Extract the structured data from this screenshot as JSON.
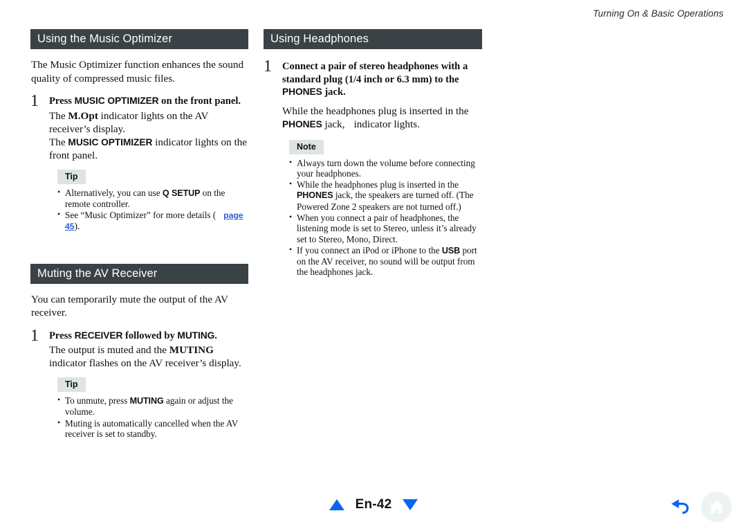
{
  "header": {
    "running_title": "Turning On & Basic Operations"
  },
  "left_column": {
    "sections": [
      {
        "heading": "Using the Music Optimizer",
        "intro": "The Music Optimizer function enhances the sound quality of compressed music files.",
        "step_number": "1",
        "step_title_pre": "Press ",
        "step_title_key": "MUSIC OPTIMIZER",
        "step_title_post": " on the front panel.",
        "body_1_a": "The ",
        "body_1_key": "M.Opt",
        "body_1_b": " indicator lights on the AV receiver’s display.",
        "body_2_a": "The ",
        "body_2_key": "MUSIC OPTIMIZER",
        "body_2_b": " indicator lights on the front panel.",
        "callout_label": "Tip",
        "bullets": [
          {
            "pre": "Alternatively, you can use ",
            "key": "Q SETUP",
            "post": " on the remote controller."
          },
          {
            "pre": "See “Music Optimizer” for more details (",
            "link": "page 45",
            "post": ")."
          }
        ]
      },
      {
        "heading": "Muting the AV Receiver",
        "intro": "You can temporarily mute the output of the AV receiver.",
        "step_number": "1",
        "step_title_pre": "Press ",
        "step_title_key": "RECEIVER",
        "step_title_mid": " followed by ",
        "step_title_key2": "MUTING",
        "step_title_post": ".",
        "body_1_a": "The output is muted and the ",
        "body_1_key": "MUTING",
        "body_1_b": " indicator flashes on the AV receiver’s display.",
        "callout_label": "Tip",
        "bullets": [
          {
            "pre": "To unmute, press ",
            "key": "MUTING",
            "post": " again or adjust the volume."
          },
          {
            "pre": "Muting is automatically cancelled when the AV receiver is set to standby.",
            "key": "",
            "post": ""
          }
        ]
      }
    ]
  },
  "right_column": {
    "section": {
      "heading": "Using Headphones",
      "step_number": "1",
      "step_title_a": "Connect a pair of stereo headphones with a standard plug (1/4 inch or 6.3 mm) to the ",
      "step_title_key": "PHONES",
      "step_title_b": " jack.",
      "body_a": "While the headphones plug is inserted in the ",
      "body_key": "PHONES",
      "body_b": " jack,",
      "body_c": "indicator lights.",
      "callout_label": "Note",
      "bullets": [
        {
          "pre": "Always turn down the volume before connecting your headphones.",
          "key": "",
          "post": ""
        },
        {
          "pre": "While the headphones plug is inserted in the ",
          "key": "PHONES",
          "post": " jack, the speakers are turned off. (The Powered Zone 2 speakers are not turned off.)"
        },
        {
          "pre": "When you connect a pair of headphones, the listening mode is set to Stereo, unless it’s already set to Stereo, Mono, Direct.",
          "key": "",
          "post": ""
        },
        {
          "pre": "If you connect an iPod or iPhone to the ",
          "key": "USB",
          "post": " port on the AV receiver, no sound will be output from the headphones jack."
        }
      ]
    }
  },
  "footer": {
    "prev_icon": "triangle-up-icon",
    "page_label": "En-42",
    "next_icon": "triangle-down-icon",
    "back_icon": "back-arrow-icon",
    "home_icon": "home-icon"
  },
  "colors": {
    "section_bar": "#3b4245",
    "badge_bg": "#dde4e1",
    "link": "#2a5fd8",
    "nav_blue": "#0a64f0",
    "home_circle": "#edf3f3"
  }
}
